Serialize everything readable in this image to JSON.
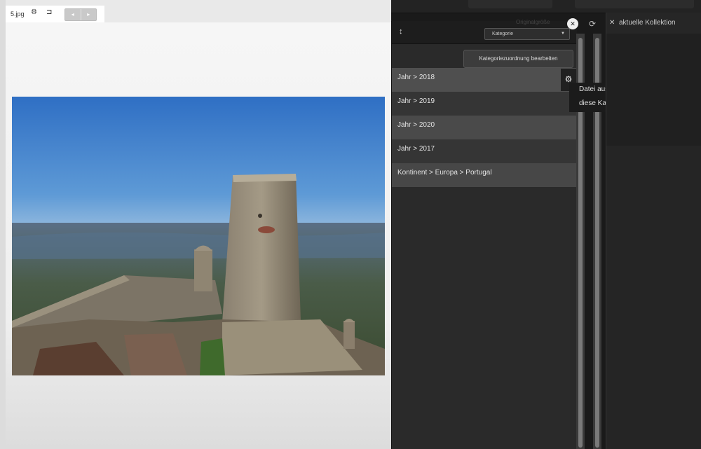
{
  "viewer": {
    "file_name": "5.jpg",
    "icons": [
      "gear-icon",
      "fit-icon"
    ],
    "nav": {
      "prev": "◂",
      "next": "▸"
    }
  },
  "categories": {
    "filter_select": "Kategorie",
    "edit_button": "Kategoriezuordnung bearbeiten",
    "rows": [
      {
        "label": "Jahr > 2018"
      },
      {
        "label": "Jahr > 2019"
      },
      {
        "label": "Jahr > 2020"
      },
      {
        "label": "Jahr > 2017"
      },
      {
        "label": "Kontinent > Europa > Portugal"
      }
    ],
    "ghost_label": "Originalgröße"
  },
  "context_menu": {
    "items": [
      {
        "label": "Datei aus dieser Kategorie entfernen"
      },
      {
        "label": "diese Kategorie anzeigen"
      }
    ]
  },
  "collection": {
    "title": "aktuelle Kollektion",
    "close": "✕"
  },
  "colors": {
    "panel_bg": "#2a2a2a",
    "row_highlight": "#4f4f4f",
    "viewer_bg": "#efefef"
  }
}
